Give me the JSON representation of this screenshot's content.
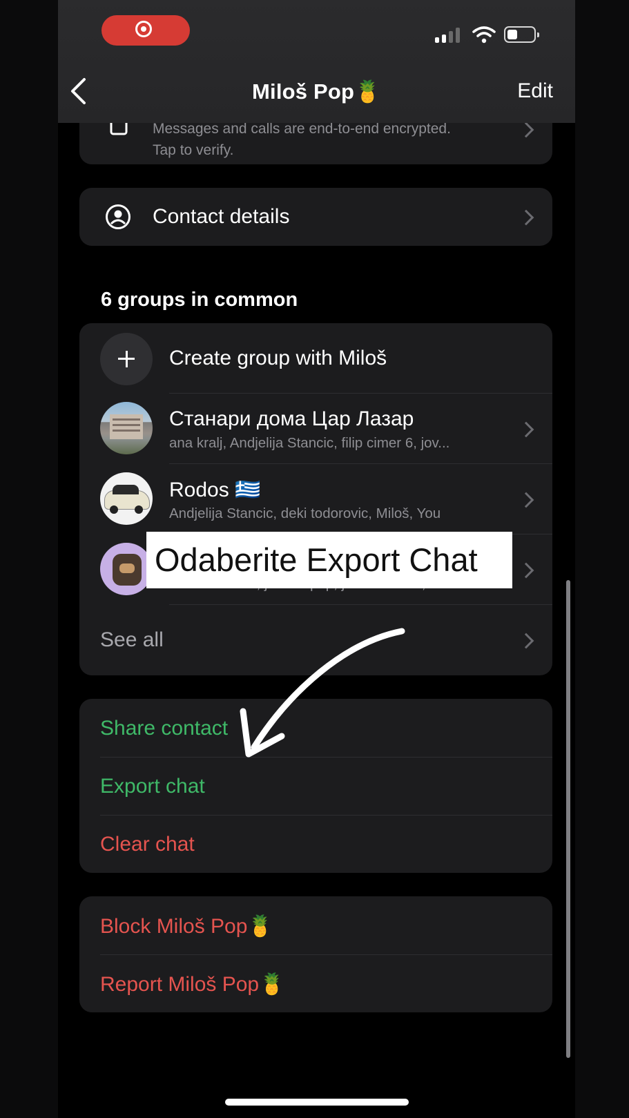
{
  "status_bar": {
    "recording_indicator": "screen-recording",
    "battery_level": 0.4
  },
  "nav": {
    "title": "Miloš Pop🍍",
    "edit_label": "Edit"
  },
  "encryption": {
    "line1": "Messages and calls are end-to-end encrypted.",
    "line2": "Tap to verify."
  },
  "contact_details": {
    "label": "Contact details"
  },
  "groups": {
    "title": "6 groups in common",
    "create_label": "Create group with Miloš",
    "items": [
      {
        "name": "Станари дома Цар Лазар",
        "members": "ana kralj, Andjelija Stancic, filip cimer 6, jov..."
      },
      {
        "name": "Rodos 🇬🇷",
        "members": "Andjelija Stancic, deki todorovic, Miloš, You"
      },
      {
        "name": "",
        "members": "deki todorovic, jovana pop, jovana maca, mi..."
      }
    ],
    "see_all_label": "See all"
  },
  "actions": {
    "share_contact": "Share contact",
    "export_chat": "Export chat",
    "clear_chat": "Clear chat"
  },
  "danger": {
    "block": "Block Miloš Pop🍍",
    "report": "Report Miloš Pop🍍"
  },
  "overlay": {
    "caption": "Odaberite Export Chat"
  },
  "colors": {
    "accent_green": "#3fb968",
    "danger_red": "#e5544f",
    "card_bg": "#1c1c1e",
    "record_red": "#d63b34"
  }
}
